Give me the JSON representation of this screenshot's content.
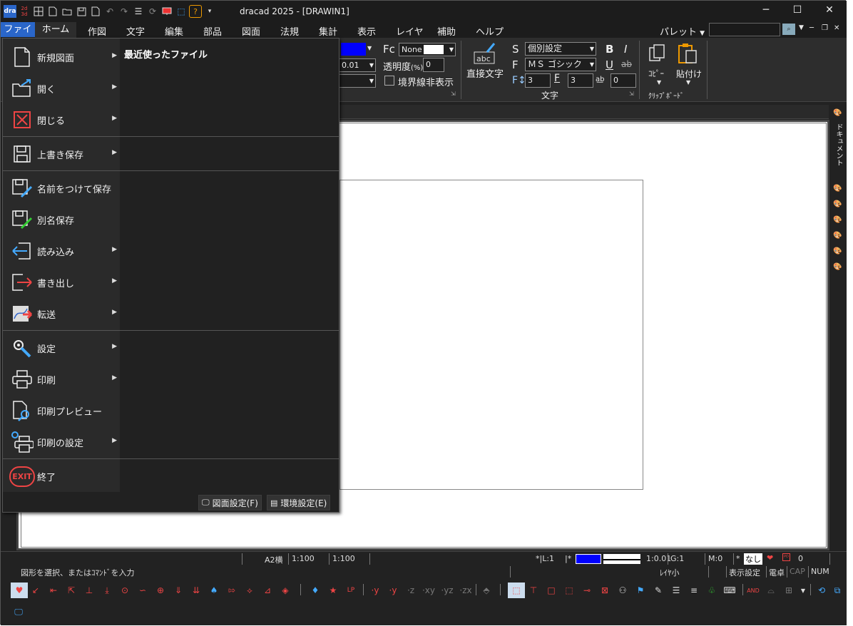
{
  "app": {
    "title": "dracad 2025 - [DRAWIN1]",
    "logo_text": "dra"
  },
  "window_controls": {
    "minimize": "─",
    "maximize": "☐",
    "close": "✕"
  },
  "menubar": {
    "file": "ファイル",
    "items": [
      "ホーム",
      "作図",
      "文字",
      "編集",
      "部品",
      "図面",
      "法規",
      "集計",
      "表示",
      "レイヤ",
      "補助",
      "ヘルプ"
    ],
    "palette": "パレット"
  },
  "ribbon": {
    "fc_label": "Fc",
    "fc_value": "None",
    "line_value": "0.01",
    "transparency_label": "透明度",
    "transparency_unit": "(%)",
    "transparency_value": "0",
    "hide_border_label": "境界線非表示",
    "direct_text_label": "直接文字",
    "s_label": "S",
    "s_value": "個別設定",
    "f_label": "F",
    "font_value": "ＭＳ ゴシック",
    "f_size_value": "3",
    "f_height_value": "3",
    "ab_value": "0",
    "bold": "B",
    "italic": "I",
    "underline": "U",
    "strike": "ab",
    "text_group": "文字",
    "copy_label": "ｺﾋﾟｰ",
    "paste_label": "貼付け",
    "clipboard_group": "ｸﾘｯﾌﾟﾎﾞｰﾄﾞ",
    "accent_color": "#0000ff"
  },
  "filemenu": {
    "recent_title": "最近使ったファイル",
    "items": [
      {
        "label": "新規図面",
        "has_sub": true
      },
      {
        "label": "開く",
        "has_sub": true
      },
      {
        "label": "閉じる",
        "has_sub": true
      },
      {
        "label": "上書き保存",
        "has_sub": true
      },
      {
        "label": "名前をつけて保存",
        "has_sub": false
      },
      {
        "label": "別名保存",
        "has_sub": false
      },
      {
        "label": "読み込み",
        "has_sub": true
      },
      {
        "label": "書き出し",
        "has_sub": true
      },
      {
        "label": "転送",
        "has_sub": true
      },
      {
        "label": "設定",
        "has_sub": true
      },
      {
        "label": "印刷",
        "has_sub": true
      },
      {
        "label": "印刷プレビュー",
        "has_sub": false
      },
      {
        "label": "印刷の設定",
        "has_sub": true
      },
      {
        "label": "終了",
        "has_sub": false
      }
    ],
    "sub_arrow": "▶",
    "exit_icon_text": "EXIT",
    "drawing_settings": "図面設定(F)",
    "env_settings": "環境設定(E)"
  },
  "sidepanel": {
    "document_tab": "ドキュメント"
  },
  "status": {
    "paper": "A2横",
    "scale1": "1:100",
    "scale2": "1:100",
    "layer": "*|L:1",
    "line_scale": "1:0.01",
    "g": "G:1",
    "m": "M:0",
    "nashi": "なし",
    "zero": "0",
    "prompt": "図形を選択、またはｺﾏﾝﾄﾞを入力",
    "layer_small": "ﾚｲﾔ小",
    "display_settings": "表示設定",
    "calc": "電卓",
    "cap": "CAP",
    "num": "NUM",
    "color_swatch": "#0000ff"
  },
  "toolbar": {
    "axis_labels": [
      "·y",
      "·y",
      "·z",
      "·xy",
      "·yz",
      "·zx"
    ]
  }
}
